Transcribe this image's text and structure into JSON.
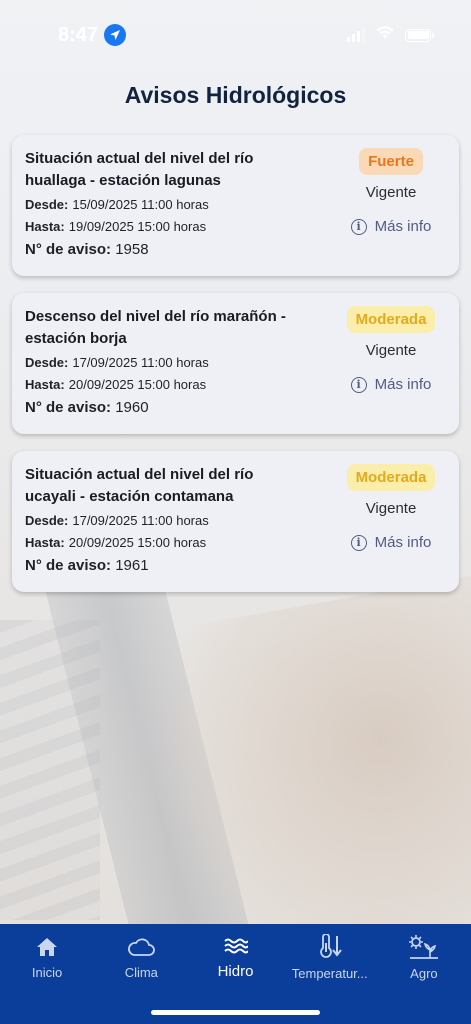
{
  "status_bar": {
    "time": "8:47"
  },
  "page_title": "Avisos Hidrológicos",
  "labels": {
    "desde": "Desde:",
    "hasta": "Hasta:",
    "aviso": "N° de aviso:",
    "more_info": "Más info"
  },
  "warnings": [
    {
      "title": "Situación actual del nivel del río huallaga - estación lagunas",
      "desde": "15/09/2025 11:00 horas",
      "hasta": "19/09/2025 15:00 horas",
      "aviso_number": "1958",
      "severity": "Fuerte",
      "status": "Vigente"
    },
    {
      "title": "Descenso del nivel del río marañón - estación borja",
      "desde": "17/09/2025 11:00 horas",
      "hasta": "20/09/2025 15:00 horas",
      "aviso_number": "1960",
      "severity": "Moderada",
      "status": "Vigente"
    },
    {
      "title": "Situación actual del nivel del río ucayali - estación contamana",
      "desde": "17/09/2025 11:00 horas",
      "hasta": "20/09/2025 15:00 horas",
      "aviso_number": "1961",
      "severity": "Moderada",
      "status": "Vigente"
    }
  ],
  "severity_colors": {
    "Fuerte": {
      "bg": "#f9d9b6",
      "fg": "#e8781b"
    },
    "Moderada": {
      "bg": "#fbeeaa",
      "fg": "#e5a91e"
    }
  },
  "nav": {
    "active": "Hidro",
    "items": [
      {
        "label": "Inicio",
        "icon": "home-icon"
      },
      {
        "label": "Clima",
        "icon": "cloud-icon"
      },
      {
        "label": "Hidro",
        "icon": "waves-icon"
      },
      {
        "label": "Temperatur...",
        "icon": "thermometer-icon"
      },
      {
        "label": "Agro",
        "icon": "agro-icon"
      }
    ]
  },
  "colors": {
    "nav_background": "#0a3e9a",
    "title": "#13233f",
    "card_background": "#eff0f5",
    "link": "#505c83"
  }
}
